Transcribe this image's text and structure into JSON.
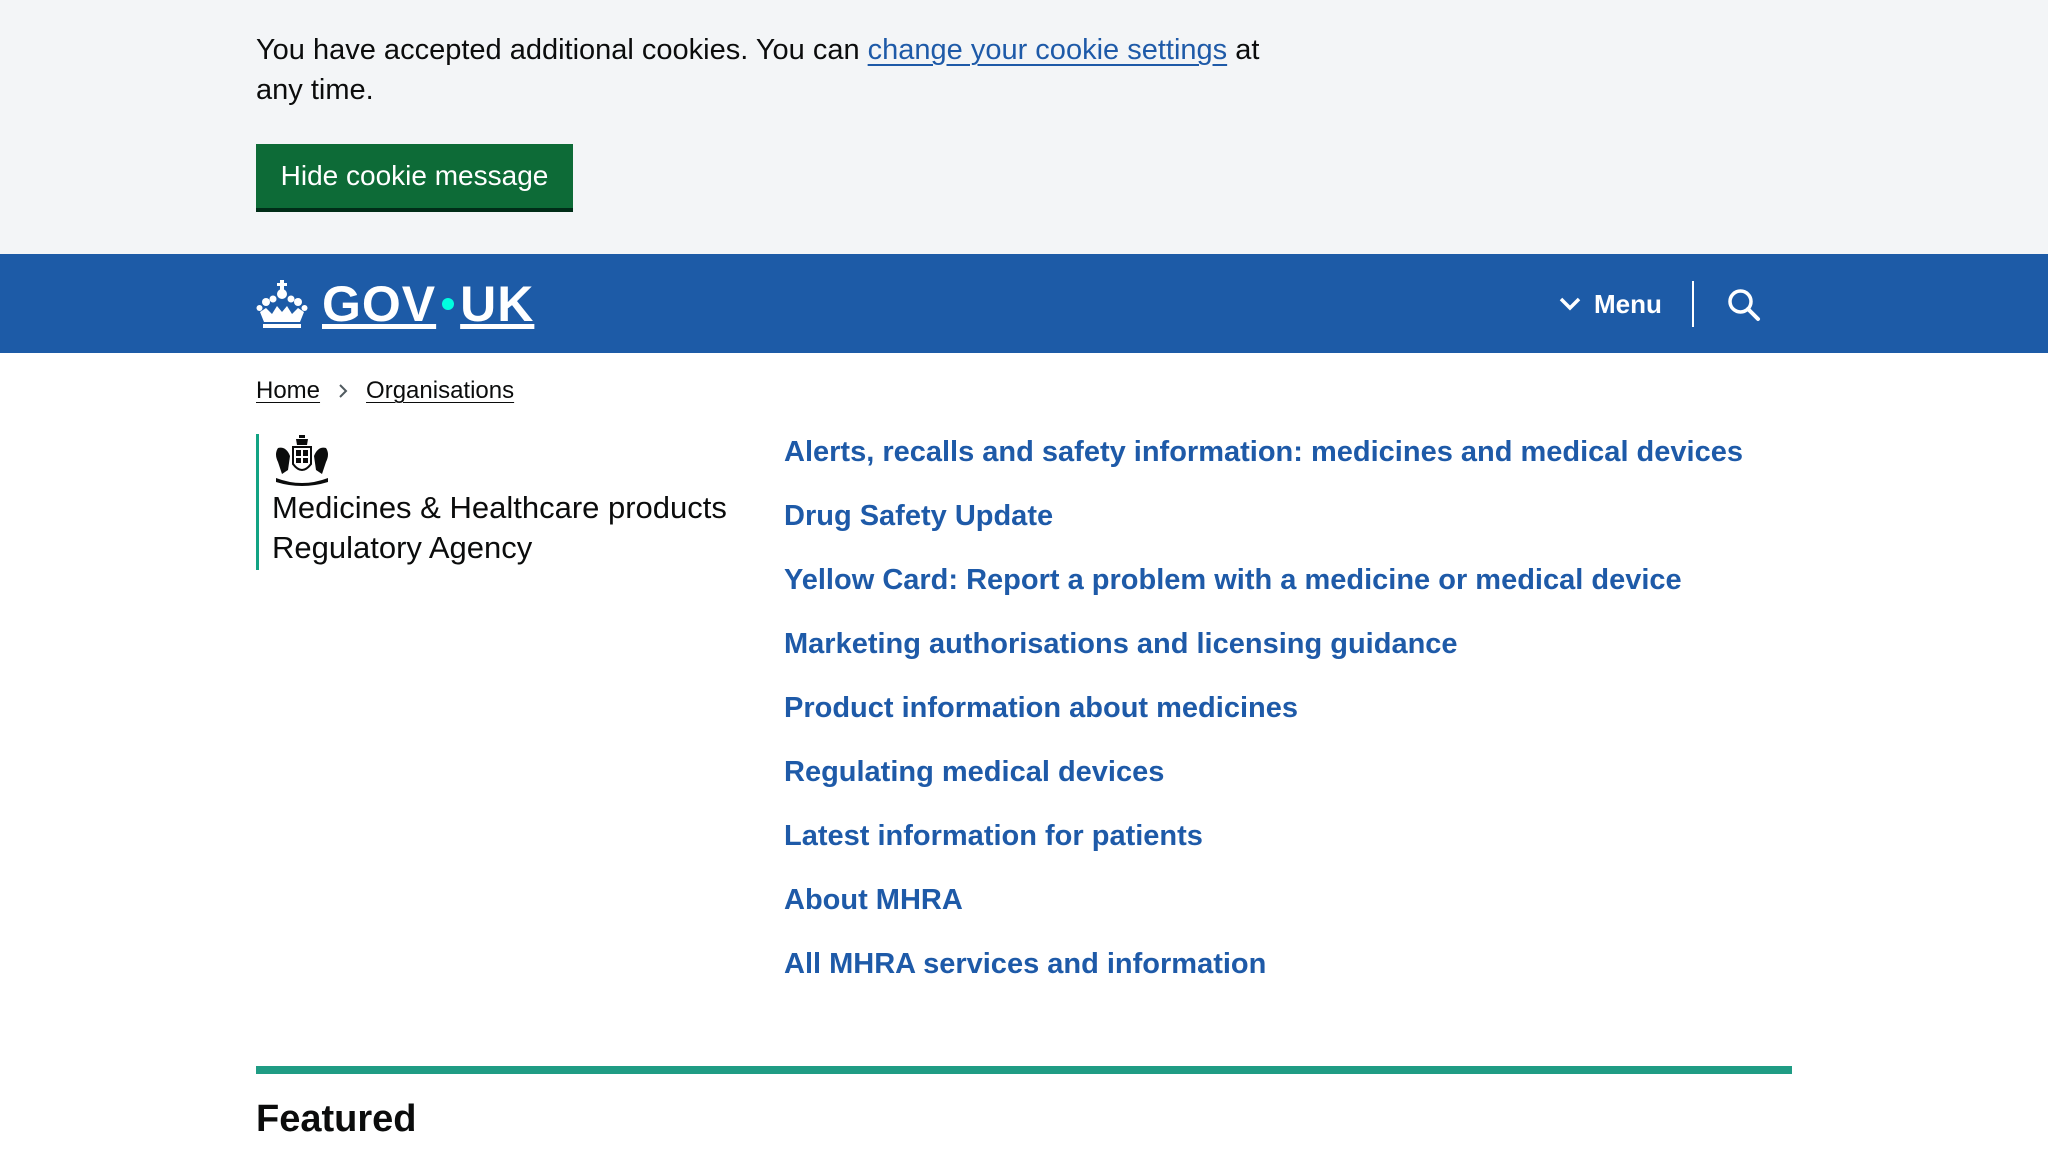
{
  "cookie_banner": {
    "message_before": "You have accepted additional cookies. You can ",
    "settings_link": "change your cookie settings",
    "message_after": " at any time.",
    "hide_button": "Hide cookie message"
  },
  "header": {
    "logo_left": "GOV",
    "logo_right": "UK",
    "menu_label": "Menu",
    "icons": [
      "crown-icon",
      "chevron-down-icon",
      "search-icon"
    ],
    "colors": {
      "header_bg": "#1d5ba7",
      "logo_dot": "#00ffe0"
    }
  },
  "breadcrumb": {
    "items": [
      "Home",
      "Organisations"
    ]
  },
  "organisation": {
    "name_line1": "Medicines & Healthcare products",
    "name_line2": "Regulatory Agency",
    "accent_color": "#12a383"
  },
  "links": [
    "Alerts, recalls and safety information: medicines and medical devices",
    "Drug Safety Update",
    "Yellow Card: Report a problem with a medicine or medical device",
    "Marketing authorisations and licensing guidance",
    "Product information about medicines",
    "Regulating medical devices",
    "Latest information for patients",
    "About MHRA",
    "All MHRA services and information"
  ],
  "featured": {
    "title": "Featured"
  },
  "colors": {
    "link": "#1e5aa8",
    "button_green": "#0d6b37",
    "banner_bg": "#f3f5f7"
  }
}
